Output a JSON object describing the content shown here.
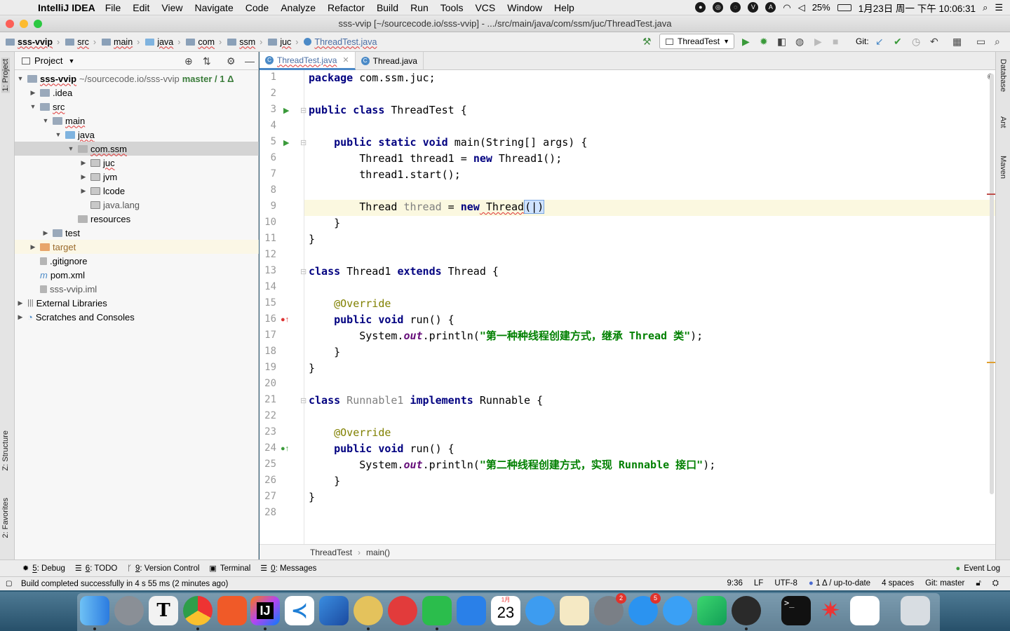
{
  "menubar": {
    "apple": "",
    "app_name": "IntelliJ IDEA",
    "items": [
      "File",
      "Edit",
      "View",
      "Navigate",
      "Code",
      "Analyze",
      "Refactor",
      "Build",
      "Run",
      "Tools",
      "VCS",
      "Window",
      "Help"
    ],
    "battery": "25%",
    "clock": "1月23日 周一 下午 10:06:31"
  },
  "window": {
    "title": "sss-vvip [~/sourcecode.io/sss-vvip] - .../src/main/java/com/ssm/juc/ThreadTest.java"
  },
  "breadcrumb": [
    "sss-vvip",
    "src",
    "main",
    "java",
    "com",
    "ssm",
    "juc",
    "ThreadTest.java"
  ],
  "run_config": "ThreadTest",
  "git_label": "Git:",
  "left_strip": {
    "project": "1: Project",
    "structure": "Z: Structure",
    "favorites": "2: Favorites"
  },
  "right_strip": {
    "database": "Database",
    "ant": "Ant",
    "maven": "Maven"
  },
  "project_panel": {
    "title": "Project",
    "root_name": "sss-vvip",
    "root_path": " ~/sourcecode.io/sss-vvip",
    "root_branch": "master / 1 Δ",
    "nodes": [
      {
        "label": ".idea"
      },
      {
        "label": "src"
      },
      {
        "label": "main"
      },
      {
        "label": "java"
      },
      {
        "label": "com.ssm"
      },
      {
        "label": "juc"
      },
      {
        "label": "jvm"
      },
      {
        "label": "lcode"
      },
      {
        "label": "java.lang"
      },
      {
        "label": "resources"
      },
      {
        "label": "test"
      },
      {
        "label": "target"
      },
      {
        "label": ".gitignore"
      },
      {
        "label": "pom.xml"
      },
      {
        "label": "sss-vvip.iml"
      },
      {
        "label": "External Libraries"
      },
      {
        "label": "Scratches and Consoles"
      }
    ]
  },
  "editor_tabs": [
    {
      "label": "ThreadTest.java",
      "active": true
    },
    {
      "label": "Thread.java",
      "active": false
    }
  ],
  "code": {
    "line_numbers": [
      "1",
      "2",
      "3",
      "4",
      "5",
      "6",
      "7",
      "8",
      "9",
      "10",
      "11",
      "12",
      "13",
      "14",
      "15",
      "16",
      "17",
      "18",
      "19",
      "20",
      "21",
      "22",
      "23",
      "24",
      "25",
      "26",
      "27",
      "28"
    ],
    "t_package": "package",
    "pkg_name": " com.ssm.juc;",
    "t_public": "public",
    "t_class": "class",
    "t_static": "static",
    "t_void": "void",
    "t_new": "new",
    "t_extends": "extends",
    "t_implements": "implements",
    "threadtest_decl": " ThreadTest {",
    "main_sig": " main(String[] args) {",
    "l6_a": "Thread1 thread1 = ",
    "l6_b": " Thread1();",
    "l7": "thread1.start();",
    "l9_a": "Thread ",
    "l9_var": "thread",
    "l9_b": " = ",
    "l9_c": " Thread",
    "l9_paren": "(|)",
    "close_brace": "}",
    "thread1_decl": " Thread1 ",
    "thread_brace": " Thread {",
    "override": "@Override",
    "run_sig": " run() {",
    "sysout_a": "System.",
    "sysout_out": "out",
    "sysout_b": ".println(",
    "str1": "\"第一种种线程创建方式，继承 Thread 类\"",
    "str2": "\"第二种线程创建方式，实现 Runnable 接口\"",
    "end_paren": ");",
    "runnable1": " Runnable1",
    "runnable_brace": " Runnable {"
  },
  "editor_breadcrumb": [
    "ThreadTest",
    "main()"
  ],
  "tool_windows": [
    {
      "num": "5",
      "label": ": Debug"
    },
    {
      "num": "6",
      "label": ": TODO"
    },
    {
      "num": "9",
      "label": ": Version Control"
    },
    {
      "num": "",
      "label": "Terminal"
    },
    {
      "num": "0",
      "label": ": Messages"
    }
  ],
  "event_log": "Event Log",
  "status": {
    "message": "Build completed successfully in 4 s 55 ms (2 minutes ago)",
    "position": "9:36",
    "line_sep": "LF",
    "encoding": "UTF-8",
    "vcs": "1 Δ / up-to-date",
    "indent": "4 spaces",
    "branch": "Git: master"
  },
  "dock": {
    "calendar_month": "1月",
    "calendar_day": "23",
    "badge_settings": "2",
    "badge_appstore": "5"
  }
}
